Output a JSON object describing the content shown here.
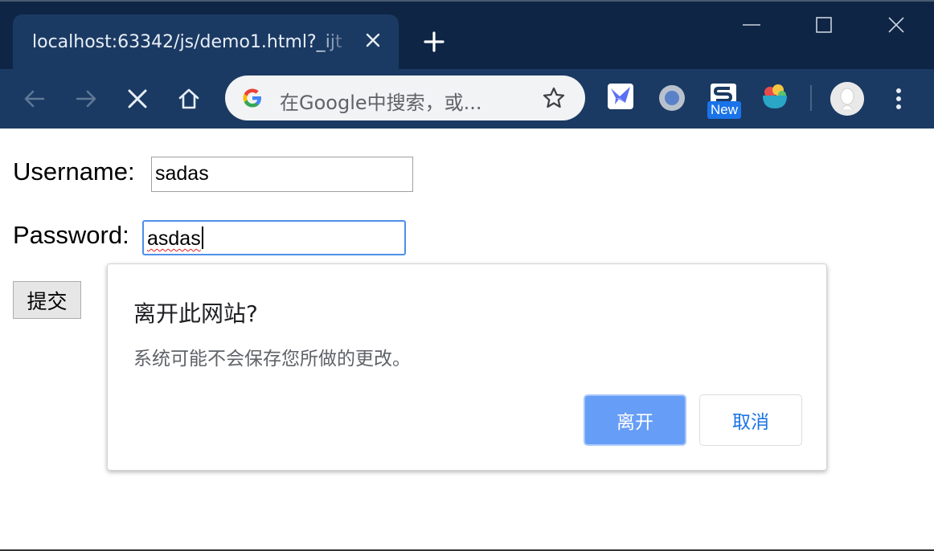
{
  "browser": {
    "tab_title": "localhost:63342/js/demo1.html?_ijt",
    "omnibox_placeholder": "在Google中搜索，或...",
    "extension_badge": "New"
  },
  "form": {
    "username_label": "Username:",
    "username_value": "sadas",
    "password_label": "Password:",
    "password_value": "asdas",
    "submit_label": "提交"
  },
  "dialog": {
    "title": "离开此网站?",
    "message": "系统可能不会保存您所做的更改。",
    "leave_label": "离开",
    "cancel_label": "取消"
  },
  "colors": {
    "titlebar": "#0f2545",
    "toolbar": "#1b3a63",
    "primary_button": "#669df6",
    "link_blue": "#1a73e8"
  }
}
